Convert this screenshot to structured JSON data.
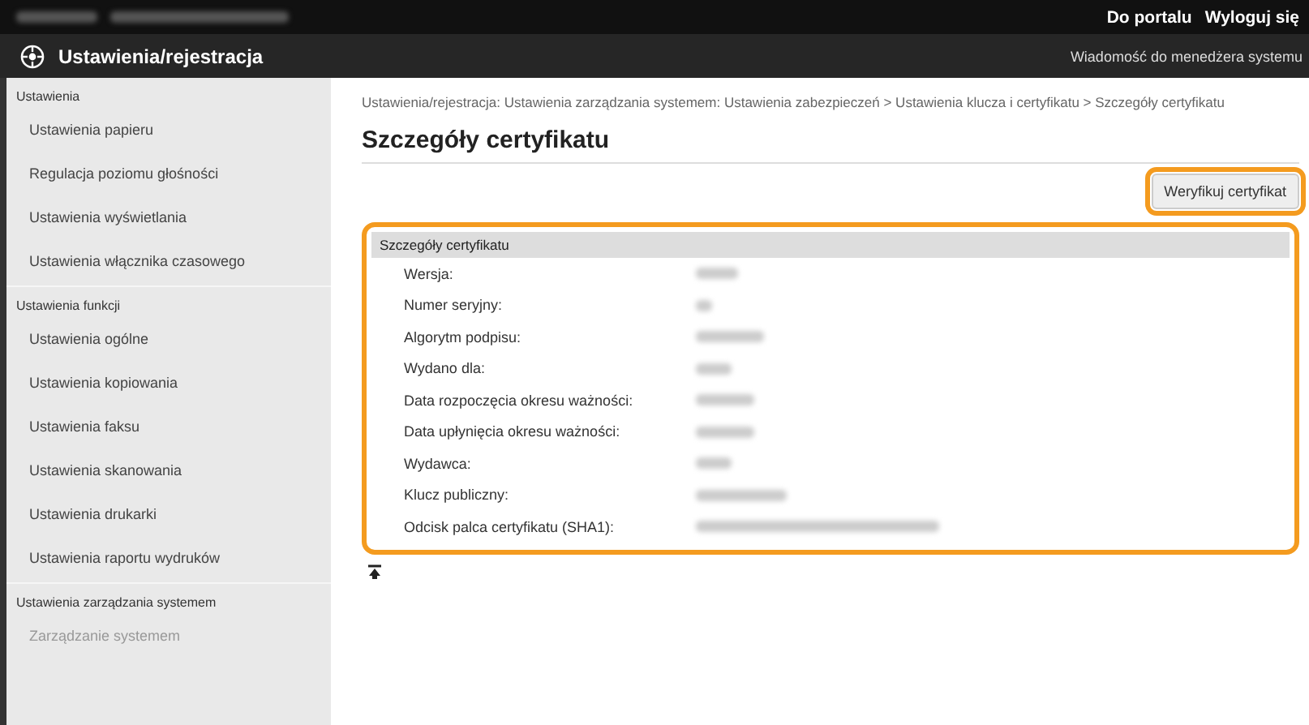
{
  "top_bar": {
    "links": [
      "Do portalu",
      "Wyloguj się"
    ]
  },
  "header": {
    "title": "Ustawienia/rejestracja",
    "message_link": "Wiadomość do menedżera systemu"
  },
  "sidebar": {
    "sections": [
      {
        "title": "Ustawienia",
        "items": [
          {
            "label": "Ustawienia papieru",
            "disabled": false
          },
          {
            "label": "Regulacja poziomu głośności",
            "disabled": false
          },
          {
            "label": "Ustawienia wyświetlania",
            "disabled": false
          },
          {
            "label": "Ustawienia włącznika czasowego",
            "disabled": false
          }
        ]
      },
      {
        "title": "Ustawienia funkcji",
        "items": [
          {
            "label": "Ustawienia ogólne",
            "disabled": false
          },
          {
            "label": "Ustawienia kopiowania",
            "disabled": false
          },
          {
            "label": "Ustawienia faksu",
            "disabled": false
          },
          {
            "label": "Ustawienia skanowania",
            "disabled": false
          },
          {
            "label": "Ustawienia drukarki",
            "disabled": false
          },
          {
            "label": "Ustawienia raportu wydruków",
            "disabled": false
          }
        ]
      },
      {
        "title": "Ustawienia zarządzania systemem",
        "items": [
          {
            "label": "Zarządzanie systemem",
            "disabled": true
          }
        ]
      }
    ]
  },
  "breadcrumb": "Ustawienia/rejestracja: Ustawienia zarządzania systemem: Ustawienia zabezpieczeń > Ustawienia klucza i certyfikatu > Szczegóły certyfikatu",
  "page_title": "Szczegóły certyfikatu",
  "verify_button": "Weryfikuj certyfikat",
  "details": {
    "title": "Szczegóły certyfikatu",
    "rows": [
      {
        "label": "Wersja:"
      },
      {
        "label": "Numer seryjny:"
      },
      {
        "label": "Algorytm podpisu:"
      },
      {
        "label": "Wydano dla:"
      },
      {
        "label": "Data rozpoczęcia okresu ważności:"
      },
      {
        "label": "Data upłynięcia okresu ważności:"
      },
      {
        "label": "Wydawca:"
      },
      {
        "label": "Klucz publiczny:"
      },
      {
        "label": "Odcisk palca certyfikatu (SHA1):"
      }
    ]
  }
}
